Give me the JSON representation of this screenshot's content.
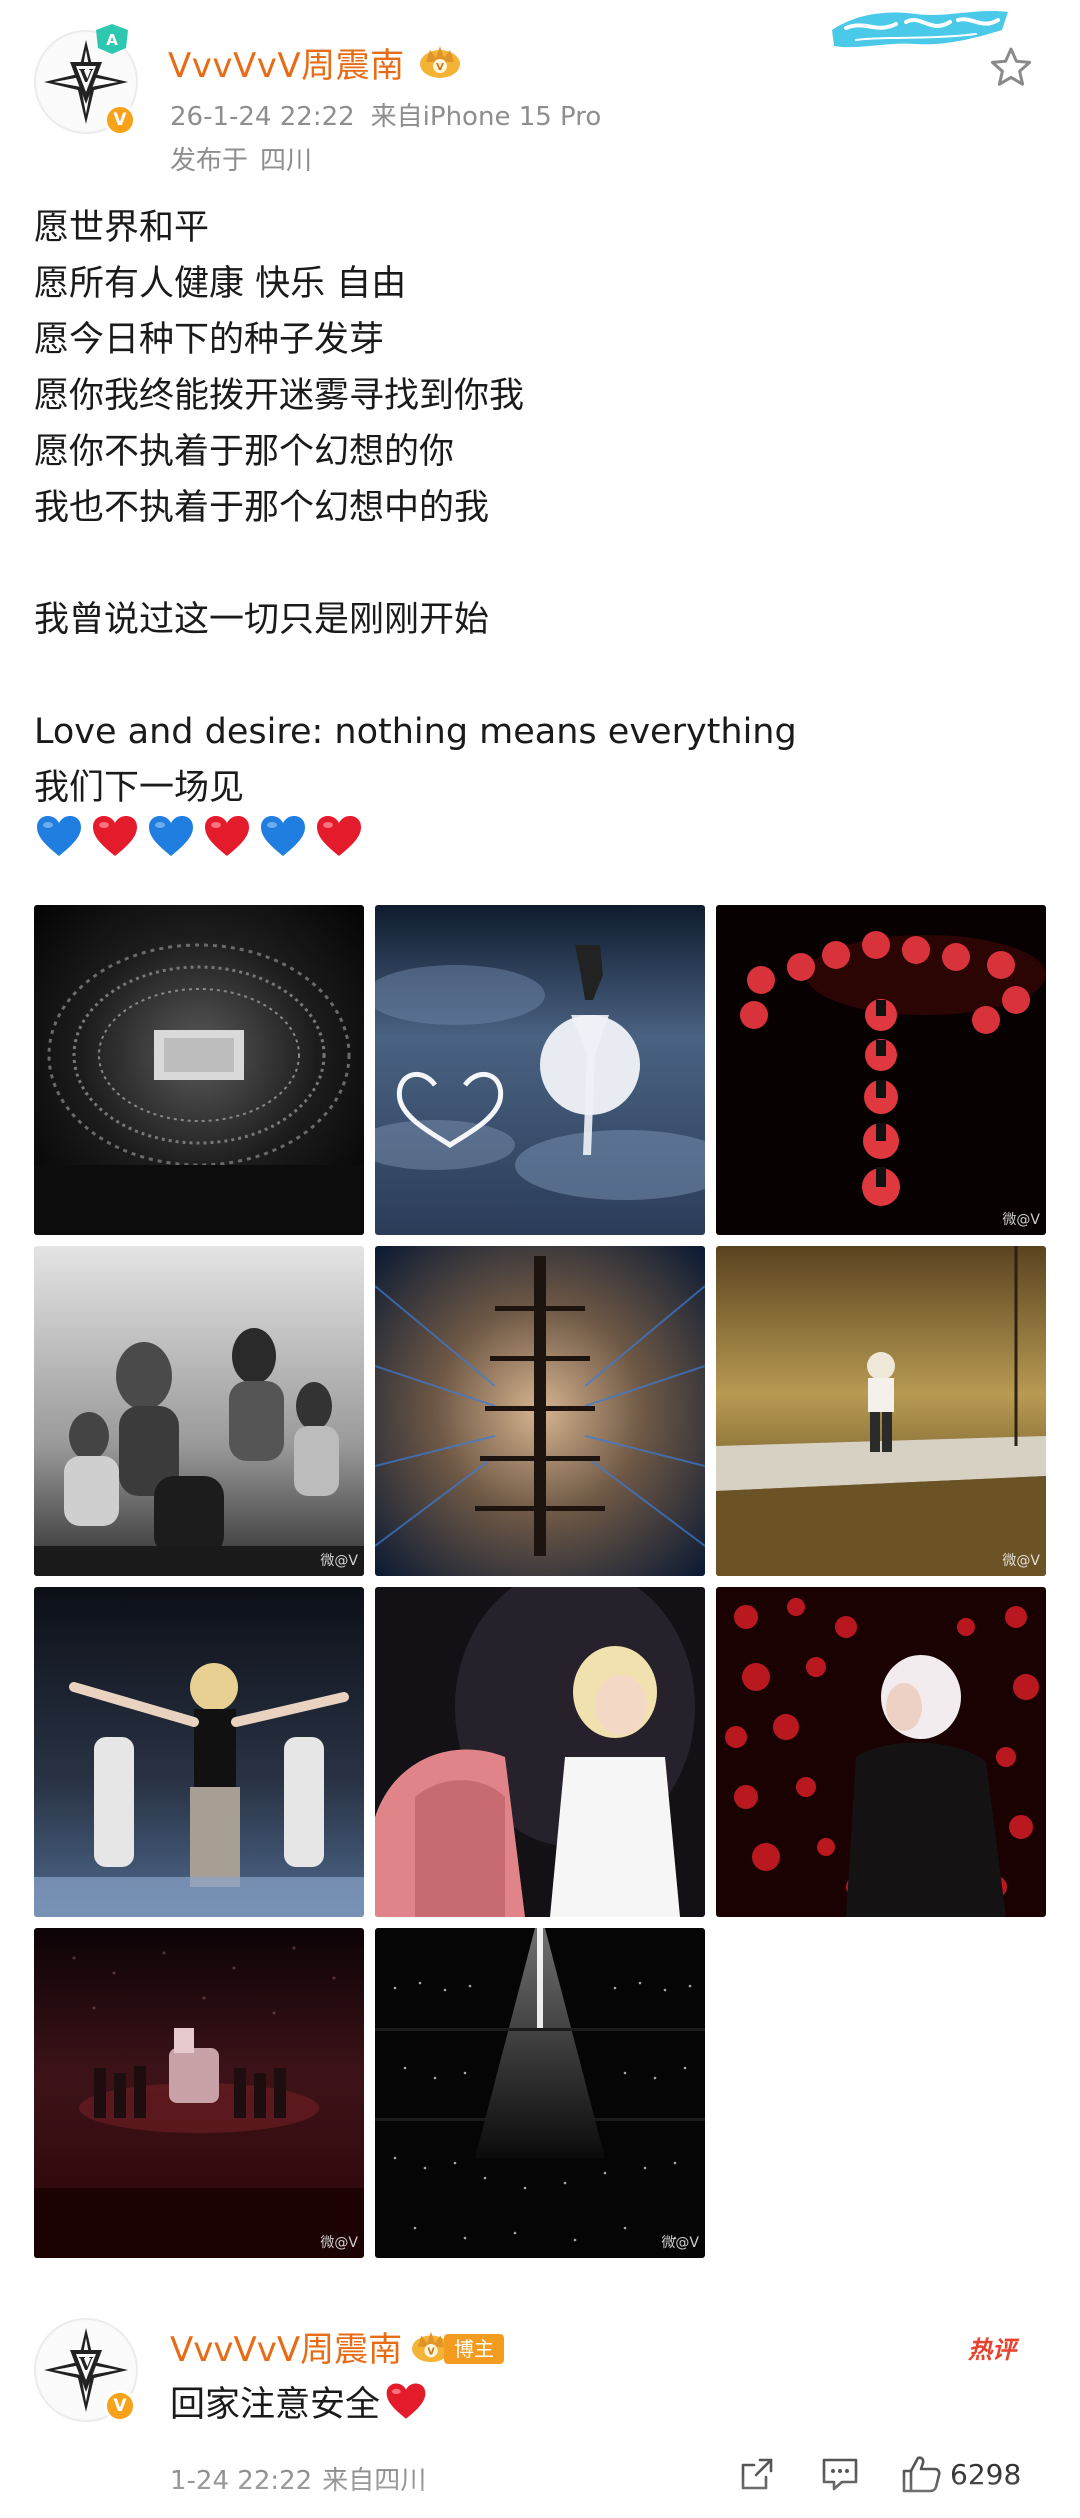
{
  "post": {
    "author": {
      "name": "VvvVvV周震南",
      "avatar_icon": "v-emblem-icon",
      "verified_mark": "V",
      "vip_badge_icon": "vip-level-badge-icon",
      "crown_icon": "crown-badge-icon"
    },
    "time": "26-1-24 22:22",
    "source": "来自iPhone 15 Pro",
    "location_prefix": "发布于",
    "location": "四川",
    "brand_stamp_icon": "brush-script-stamp-icon",
    "star_icon": "star-outline-icon",
    "text_lines": [
      "愿世界和平",
      "愿所有人健康 快乐 自由",
      "愿今日种下的种子发芽",
      "愿你我终能拨开迷雾寻找到你我",
      "愿你不执着于那个幻想的你",
      "我也不执着于那个幻想中的我",
      "",
      "我曾说过这一切只是刚刚开始",
      "",
      "Love and desire: nothing means everything",
      "我们下一场见"
    ],
    "emojis": [
      "blue-heart-icon",
      "red-heart-icon",
      "blue-heart-icon",
      "red-heart-icon",
      "blue-heart-icon",
      "red-heart-icon"
    ],
    "photos": [
      {
        "name": "arena-aerial-photo",
        "watermark": "",
        "palette": [
          "#2b2b2b",
          "#050505"
        ]
      },
      {
        "name": "moon-horse-cloud-photo",
        "watermark": "",
        "palette": [
          "#5a6f8e",
          "#0d1626"
        ]
      },
      {
        "name": "red-circles-stage-photo",
        "watermark": "微@V",
        "palette": [
          "#4a0606",
          "#060000"
        ]
      },
      {
        "name": "dancers-monochrome-photo",
        "watermark": "微@V",
        "palette": [
          "#d8d8d8",
          "#3d3d3d"
        ]
      },
      {
        "name": "lineup-lightspeed-photo",
        "watermark": "",
        "palette": [
          "#a9876a",
          "#0c1a2f"
        ]
      },
      {
        "name": "golden-stage-performer-photo",
        "watermark": "微@V",
        "palette": [
          "#b89a52",
          "#3d2c10"
        ]
      },
      {
        "name": "arms-spread-performer-photo",
        "watermark": "",
        "palette": [
          "#4a5870",
          "#0c0f16"
        ]
      },
      {
        "name": "blonde-singer-white-shirt-photo",
        "watermark": "",
        "palette": [
          "#2b2630",
          "#0b090c"
        ]
      },
      {
        "name": "red-bokeh-singer-photo",
        "watermark": "",
        "palette": [
          "#7a0c10",
          "#120102"
        ]
      },
      {
        "name": "red-stage-group-photo",
        "watermark": "微@V",
        "palette": [
          "#3d1318",
          "#040102"
        ]
      },
      {
        "name": "spotlight-crowd-photo",
        "watermark": "微@V",
        "palette": [
          "#1d1d1d",
          "#030303"
        ]
      }
    ]
  },
  "comment": {
    "author": "VvvVvV周震南",
    "badge": "博主",
    "hot_tag": "热评",
    "text": "回家注意安全",
    "text_emoji": "red-heart-icon",
    "time": "1-24 22:22",
    "source": "来自四川",
    "share_icon": "share-icon",
    "reply_icon": "comment-icon",
    "like_icon": "thumbs-up-icon",
    "like_count": "6298"
  },
  "colors": {
    "username": "#e86b16",
    "meta": "#8e8e8e",
    "verified": "#f7a21b",
    "hot": "#e8412c",
    "stamp": "#36c3e6",
    "heart_blue": "#1f7ee0",
    "heart_red": "#e31b2b"
  }
}
